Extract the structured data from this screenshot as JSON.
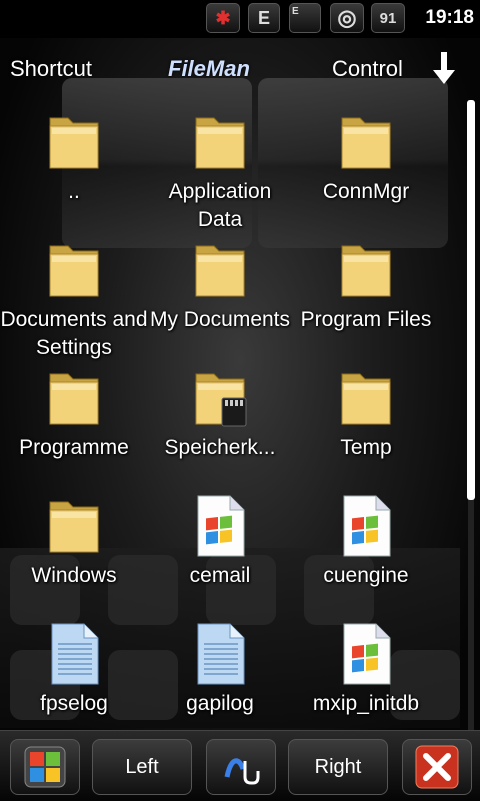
{
  "statusbar": {
    "icons": [
      {
        "name": "bluetooth-icon",
        "glyph": "✱"
      },
      {
        "name": "network-e-icon",
        "glyph": "E"
      },
      {
        "name": "signal-icon",
        "glyph": "E"
      },
      {
        "name": "media-disc-icon",
        "glyph": "◎"
      },
      {
        "name": "battery-icon",
        "glyph": "91"
      }
    ],
    "time": "19:18"
  },
  "menubar": {
    "shortcut": "Shortcut",
    "fileman": "FileMan",
    "control": "Control"
  },
  "files": [
    {
      "label": "..",
      "type": "folder"
    },
    {
      "label": "Application Data",
      "type": "folder"
    },
    {
      "label": "ConnMgr",
      "type": "folder"
    },
    {
      "label": "Documents and Settings",
      "type": "folder"
    },
    {
      "label": "My Documents",
      "type": "folder"
    },
    {
      "label": "Program Files",
      "type": "folder"
    },
    {
      "label": "Programme",
      "type": "folder"
    },
    {
      "label": "Speicherk...",
      "type": "storage-card"
    },
    {
      "label": "Temp",
      "type": "folder"
    },
    {
      "label": "Windows",
      "type": "folder"
    },
    {
      "label": "cemail",
      "type": "windows-file"
    },
    {
      "label": "cuengine",
      "type": "windows-file"
    },
    {
      "label": "fpselog",
      "type": "text-file"
    },
    {
      "label": "gapilog",
      "type": "text-file"
    },
    {
      "label": "mxip_initdb",
      "type": "windows-file"
    }
  ],
  "bottombar": {
    "left": "Left",
    "right": "Right"
  },
  "colors": {
    "folder": "#f3d37a",
    "folder_dark": "#c9a443",
    "close_red": "#e0402a"
  }
}
